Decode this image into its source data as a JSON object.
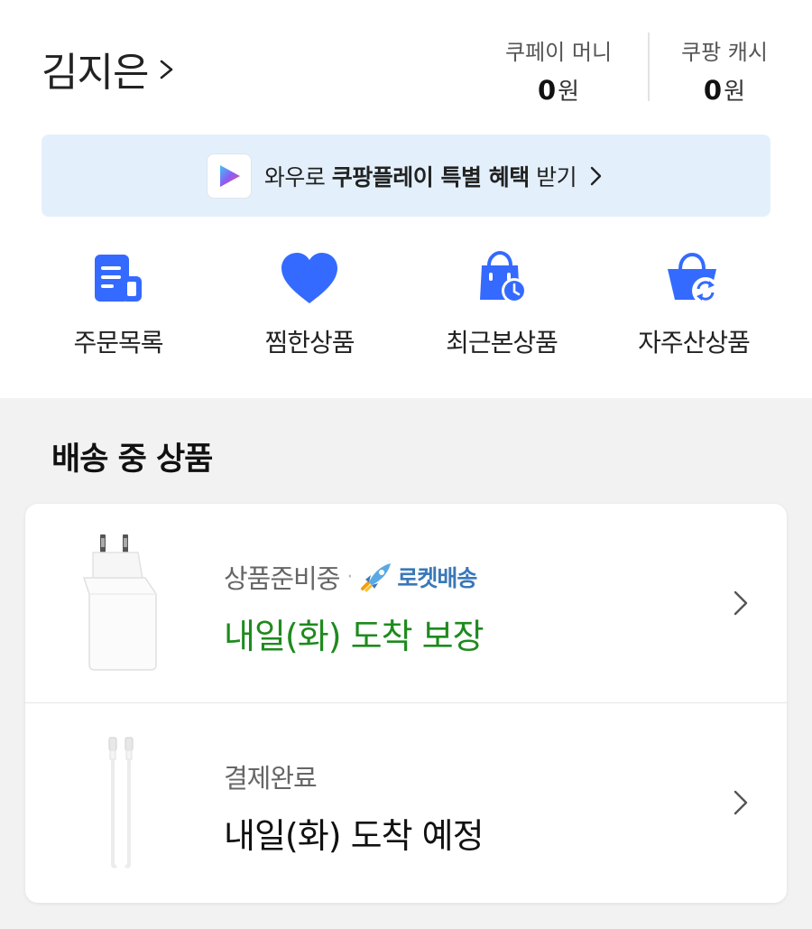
{
  "profile": {
    "name": "김지은"
  },
  "wallet": [
    {
      "label": "쿠페이 머니",
      "amount": "0",
      "unit": "원"
    },
    {
      "label": "쿠팡 캐시",
      "amount": "0",
      "unit": "원"
    }
  ],
  "banner": {
    "prefix": "와우로 ",
    "bold": "쿠팡플레이 특별 혜택",
    "suffix": " 받기"
  },
  "quick_menu": [
    {
      "label": "주문목록",
      "icon": "receipt-icon"
    },
    {
      "label": "찜한상품",
      "icon": "heart-icon"
    },
    {
      "label": "최근본상품",
      "icon": "shopping-bag-clock-icon"
    },
    {
      "label": "자주산상품",
      "icon": "basket-refresh-icon"
    }
  ],
  "section": {
    "title": "배송 중 상품"
  },
  "deliveries": [
    {
      "status": "상품준비중",
      "badge": "로켓배송",
      "eta": "내일(화) 도착 보장",
      "eta_color": "#1e8a1e",
      "image": "power-adapter-icon"
    },
    {
      "status": "결제완료",
      "badge": "",
      "eta": "내일(화) 도착 예정",
      "eta_color": "#111111",
      "image": "usb-c-cable-icon"
    }
  ],
  "colors": {
    "accent": "#346aff",
    "banner_bg": "#e3f0fc",
    "guarantee_green": "#1e8a1e",
    "rocket_blue": "#3a78b8"
  }
}
